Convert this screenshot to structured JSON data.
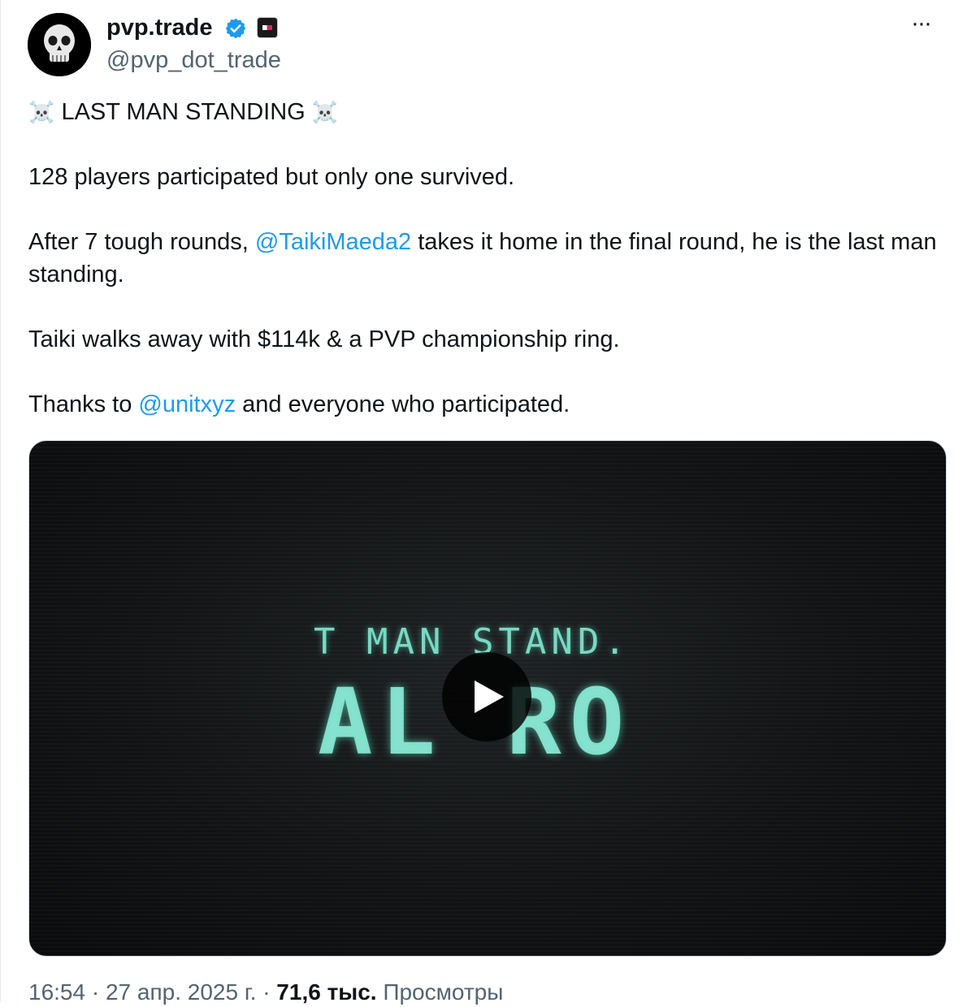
{
  "author": {
    "display_name": "pvp.trade",
    "handle": "@pvp_dot_trade",
    "verified_icon": "verified-badge-icon",
    "affiliate_icon": "affiliate-badge-icon",
    "avatar_icon": "skull-avatar"
  },
  "menu": {
    "more_label": "···"
  },
  "post": {
    "line1": {
      "skull_left": "☠️",
      "text": "LAST MAN STANDING",
      "skull_right": "☠️"
    },
    "line2": "128 players participated but only one survived.",
    "line3": {
      "prefix": "After 7 tough rounds,",
      "mention": "@TaikiMaeda2",
      "suffix": "takes it home in the final round, he is the last man standing."
    },
    "line4": "Taiki walks away with $114k & a PVP championship ring.",
    "line5": {
      "prefix": "Thanks to",
      "mention": "@unitxyz",
      "suffix": "and everyone who participated."
    }
  },
  "media": {
    "type": "video",
    "frame_text_line1": "T MAN STAND.",
    "frame_text_line2": "AL RO",
    "play_icon": "play-icon"
  },
  "footer": {
    "time": "16:54",
    "sep1": "·",
    "date": "27 апр. 2025 г.",
    "sep2": "·",
    "views_count": "71,6 тыс.",
    "views_label": "Просмотры"
  },
  "colors": {
    "link": "#1d9bf0",
    "text": "#0f1419",
    "secondary": "#536471",
    "video_glow": "#7ad8c4"
  }
}
